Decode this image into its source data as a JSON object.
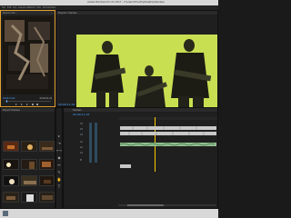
{
  "window": {
    "title": "Adobe Premiere Pro CC 2017 - C:\\Users\\Timothy\\Desktop\\fearless"
  },
  "menu": {
    "items": [
      "File",
      "Edit",
      "Clip",
      "Sequence",
      "Marker",
      "Title",
      "Window",
      "Help"
    ]
  },
  "source_monitor": {
    "tab_label": "Source: CYL...",
    "timecode": "00;00;21;04"
  },
  "program_monitor": {
    "tab_label": "Program: Fearless",
    "timecode": "00;00;11;16"
  },
  "project_panel": {
    "tab_label": "Project: Fearless"
  },
  "timeline": {
    "tab_label": "Fearless",
    "timecode": "00;00;11;16",
    "tracks": [
      "V3",
      "V2",
      "V1",
      "A1",
      "A2",
      "A3",
      "M"
    ]
  },
  "colors": {
    "accent": "#4aa3ff",
    "clip_video": "#c8c8c8",
    "clip_audio": "#8fbf8f",
    "playhead": "#ffcc00"
  }
}
